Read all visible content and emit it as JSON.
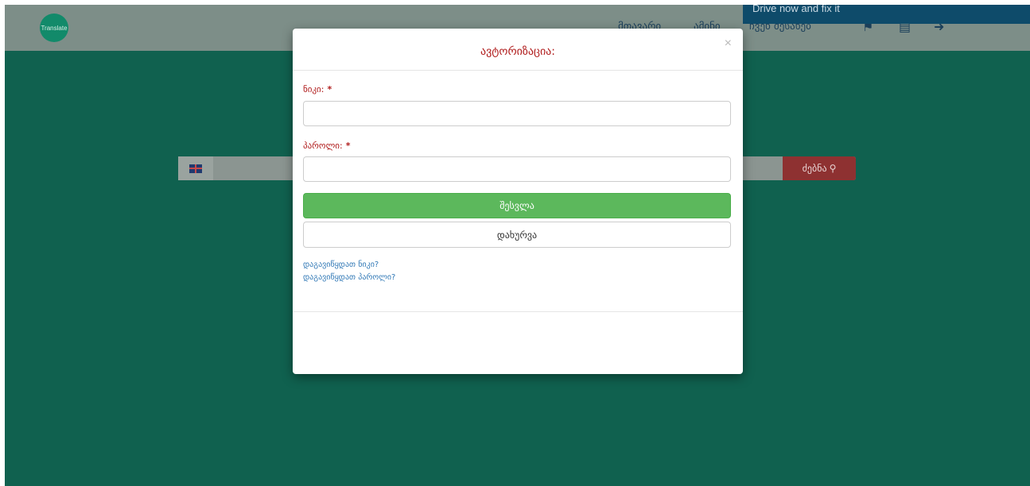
{
  "navbar": {
    "logo_text": "Translate",
    "links": [
      "მთავარი",
      "ამინი",
      "ჩვენ შესახებ"
    ],
    "icons": [
      "flag-icon",
      "save-icon",
      "login-icon"
    ],
    "banner_text": "Drive now and fix it"
  },
  "search": {
    "button_label": "ძებნა",
    "button_icon": "search-icon"
  },
  "modal": {
    "title": "ავტორიზაცია:",
    "close_symbol": "×",
    "username_label": "ნიკი:",
    "password_label": "პაროლი:",
    "required_mark": "*",
    "login_button": "შესვლა",
    "close_button": "დახურვა",
    "forgot_username": "დაგავიწყდათ ნიკი?",
    "forgot_password": "დაგავიწყდათ პაროლი?"
  },
  "colors": {
    "page_bg": "#10614f",
    "navbar_bg": "#7d8e88",
    "accent_red": "#b01c1c",
    "login_green": "#5cb85c",
    "link_blue": "#337ab7"
  }
}
